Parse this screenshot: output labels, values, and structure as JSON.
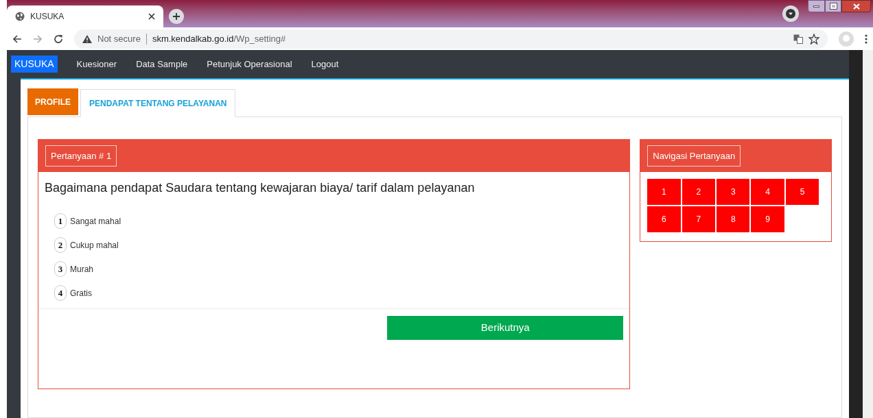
{
  "browser": {
    "tab_title": "KUSUKA",
    "security": "Not secure",
    "url_host": "skm.kendalkab.go.id",
    "url_path": "/Wp_setting#"
  },
  "navbar": {
    "brand": "KUSUKA",
    "items": [
      "Kuesioner",
      "Data Sample",
      "Petunjuk Operasional",
      "Logout"
    ]
  },
  "tabs": [
    {
      "label": "PROFILE",
      "selected": false
    },
    {
      "label": "PENDAPAT TENTANG PELAYANAN",
      "selected": true
    }
  ],
  "question": {
    "header": "Pertanyaan # 1",
    "text": "Bagaimana pendapat Saudara tentang kewajaran biaya/ tarif dalam pelayanan",
    "options": [
      {
        "number": "1",
        "label": "Sangat mahal"
      },
      {
        "number": "2",
        "label": "Cukup mahal"
      },
      {
        "number": "3",
        "label": "Murah"
      },
      {
        "number": "4",
        "label": "Gratis"
      }
    ],
    "next_button": "Berikutnya"
  },
  "navigation": {
    "title": "Navigasi Pertanyaan",
    "numbers": [
      "1",
      "2",
      "3",
      "4",
      "5",
      "6",
      "7",
      "8",
      "9"
    ]
  }
}
